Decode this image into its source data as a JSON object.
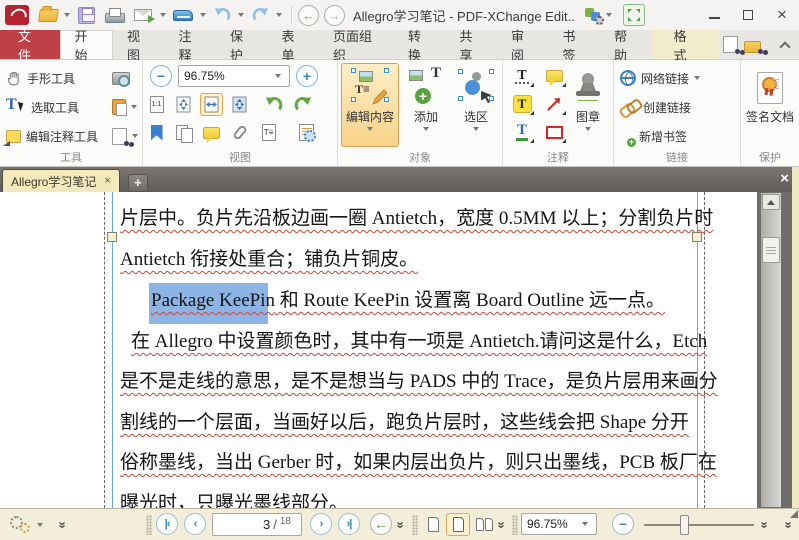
{
  "titlebar": {
    "title": "Allegro学习笔记 - PDF-XChange Edit..",
    "back": "←",
    "forward": "→",
    "minimize": "–",
    "close": "×"
  },
  "ribbon": {
    "tabs": [
      "文件",
      "开始",
      "视图",
      "注释",
      "保护",
      "表单",
      "页面组织",
      "转换",
      "共享",
      "审阅",
      "书签",
      "帮助",
      "格式"
    ],
    "active_tab": "开始"
  },
  "tools": {
    "hand": "手形工具",
    "select": "选取工具",
    "edit_annot": "编辑注释工具",
    "label": "工具"
  },
  "view": {
    "zoom": "96.75%",
    "one_to_one": "1:1",
    "label": "视图"
  },
  "objects": {
    "edit_content": "编辑内容",
    "add": "添加",
    "selection": "选区",
    "label": "对象"
  },
  "annots": {
    "stamp": "图章",
    "label": "注释",
    "typewriter": "T",
    "highlight": "T",
    "text_color": "T"
  },
  "links": {
    "weblink": "网络链接",
    "create": "创建链接",
    "bookmark": "新增书签",
    "label": "链接"
  },
  "protect": {
    "sign": "签名文档",
    "label": "保护"
  },
  "doctab": {
    "title": "Allegro学习笔记",
    "close": "×",
    "add": "+",
    "panel_close": "×"
  },
  "doc": {
    "line1": "片层中。负片先沿板边画一圈 Antietch，宽度 0.5MM 以上；分割负片时",
    "line2": "Antietch 衔接处重合；铺负片铜皮。",
    "line3_sel": "Package KeePin",
    "line3_rest": " 和 Route KeePin 设置离 Board Outline 远一点。",
    "line4": "在 Allegro 中设置颜色时，其中有一项是 Antietch.请问这是什么，Etch",
    "line5": "是不是走线的意思，是不是想当与 PADS 中的 Trace，是负片层用来画分",
    "line6": "割线的一个层面，当画好以后，跑负片层时，这些线会把 Shape 分开",
    "line7": "俗称墨线，当出 Gerber 时，如果内层出负片，则只出墨线，PCB 板厂在",
    "line8": "曝光时，只曝光墨线部分。"
  },
  "statusbar": {
    "page": "3",
    "sep": "/",
    "total": "18",
    "zoom": "96.75%"
  },
  "colors": {
    "file_tab_red": "#bf4146",
    "format_tab": "#f3ecca",
    "active_button_orange": "#f7d389",
    "doc_tab_cream": "#f3e9ba",
    "text_selection_blue": "#8cb5e6",
    "spellcheck_red": "#c9473a"
  }
}
